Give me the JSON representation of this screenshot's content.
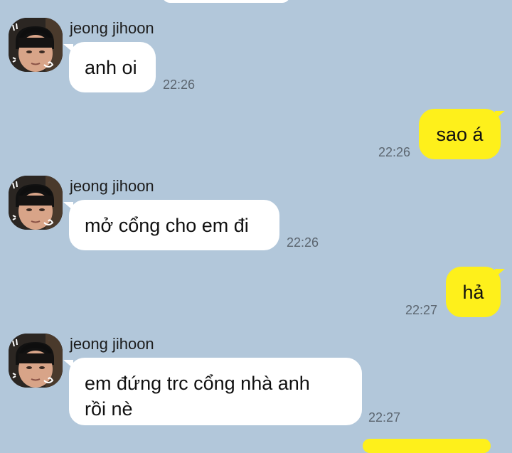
{
  "chat": {
    "messages": [
      {
        "sender": "jeong jihoon",
        "text": "anh oi",
        "time": "22:26",
        "direction": "incoming"
      },
      {
        "text": "sao á",
        "time": "22:26",
        "direction": "outgoing"
      },
      {
        "sender": "jeong jihoon",
        "text": "mở cổng cho em đi",
        "time": "22:26",
        "direction": "incoming"
      },
      {
        "text": "hả",
        "time": "22:27",
        "direction": "outgoing"
      },
      {
        "sender": "jeong jihoon",
        "text": "em đứng trc cổng nhà anh\nrồi nè",
        "time": "22:27",
        "direction": "incoming"
      }
    ]
  },
  "colors": {
    "background": "#b2c7da",
    "incoming_bubble": "#ffffff",
    "outgoing_bubble": "#fef01b",
    "timestamp": "#5c6670"
  },
  "icons": {
    "avatar": "profile-photo-avatar"
  }
}
